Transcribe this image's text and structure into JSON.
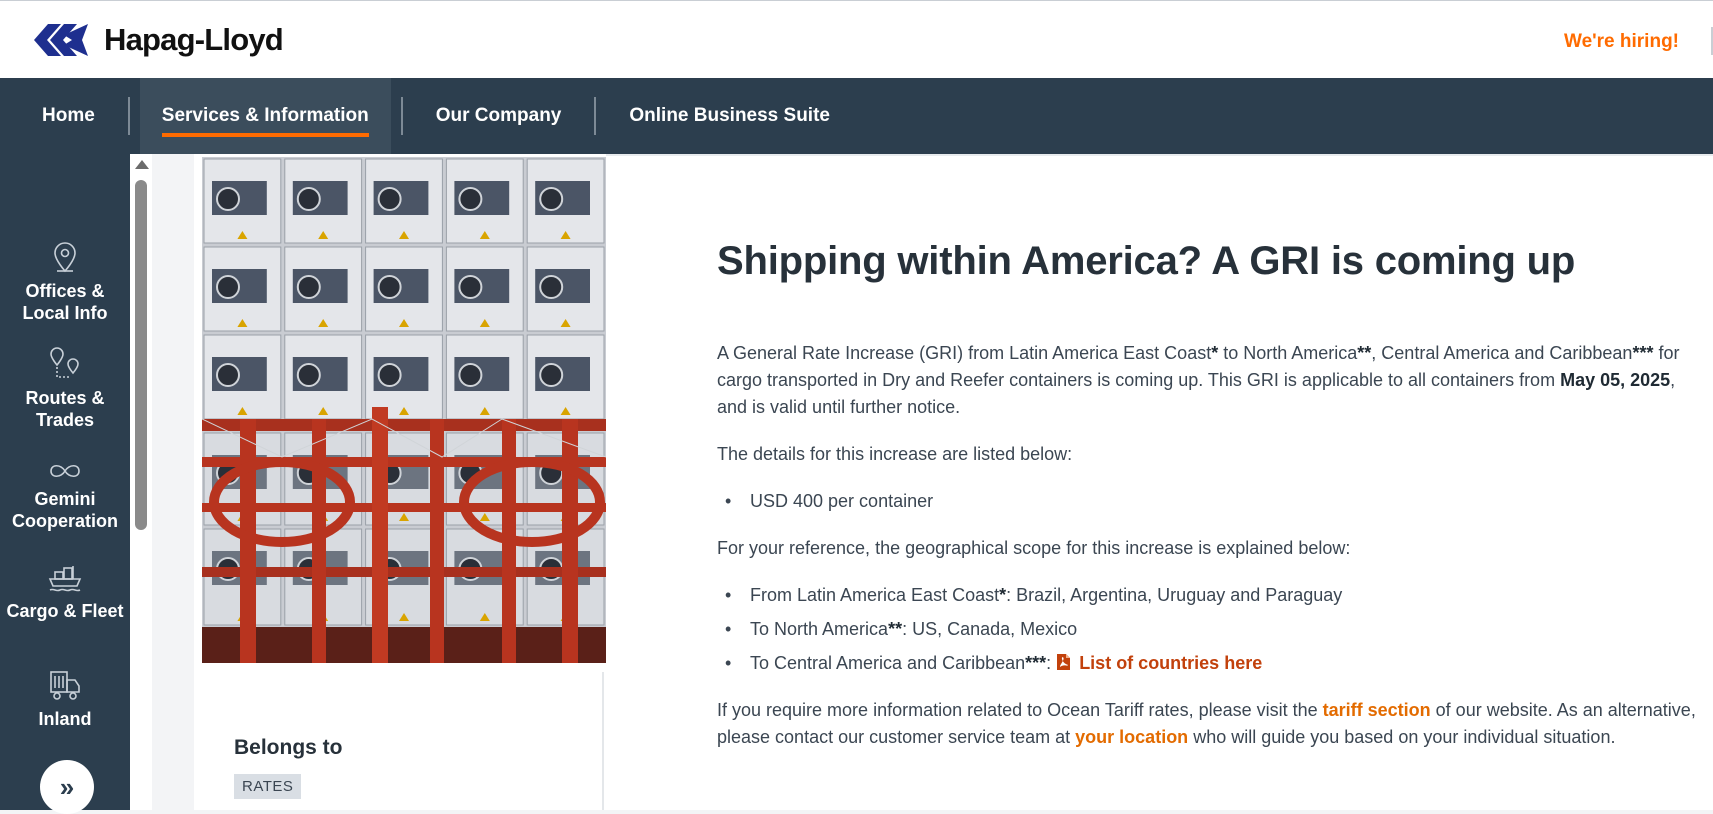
{
  "header": {
    "brand": "Hapag-Lloyd",
    "hiring_link": "We're hiring!",
    "colors": {
      "accent": "#ff6b00",
      "nav_bg": "#2c3e4e"
    }
  },
  "nav": {
    "items": [
      {
        "label": "Home"
      },
      {
        "label": "Services & Information"
      },
      {
        "label": "Our Company"
      },
      {
        "label": "Online Business Suite"
      }
    ],
    "active": "Services & Information"
  },
  "sidebar": {
    "items": [
      {
        "label": "Offices & Local Info",
        "icon": "location-pin-icon"
      },
      {
        "label": "Routes & Trades",
        "icon": "route-pins-icon"
      },
      {
        "label": "Gemini Cooperation",
        "icon": "infinity-link-icon"
      },
      {
        "label": "Cargo & Fleet",
        "icon": "ship-icon"
      },
      {
        "label": "Inland",
        "icon": "truck-icon"
      }
    ],
    "expand_icon": "double-chevron-right-icon",
    "expand_glyph": "»"
  },
  "aside": {
    "image_alt": "Stacked reefer containers on a ship",
    "belongs_label": "Belongs to",
    "tag": "RATES"
  },
  "article": {
    "title": "Shipping within America? A GRI is coming up",
    "intro": {
      "t1": "A General Rate Increase (GRI) from Latin America East Coast",
      "m1": "*",
      "t2": " to North America",
      "m2": "**",
      "t3": ", Central America and Caribbean",
      "m3": "***",
      "t4": " for cargo transported in Dry and Reefer containers is coming up. This GRI is applicable to all containers from ",
      "date": "May 05, 2025",
      "t5": ", and is valid until further notice."
    },
    "details_intro": "The details for this increase are listed below:",
    "details": [
      "USD 400 per container"
    ],
    "scope_intro": "For your reference, the geographical scope for this increase is explained below:",
    "scope": [
      {
        "pre": "From Latin America East Coast",
        "mark": "*",
        "post": ": Brazil, Argentina, Uruguay and Paraguay"
      },
      {
        "pre": "To North America",
        "mark": "**",
        "post": ": US, Canada, Mexico"
      },
      {
        "pre": "To Central America and Caribbean",
        "mark": "***",
        "post": ": "
      }
    ],
    "pdf_link": "List of countries here",
    "pdf_icon": "pdf-file-icon",
    "closing": {
      "t1": "If you require more information related to Ocean Tariff rates, please visit the ",
      "link1": "tariff section",
      "t2": " of our website. As an alternative, please contact our customer service team at ",
      "link2": "your location",
      "t3": " who will guide you based on your individual situation."
    }
  }
}
